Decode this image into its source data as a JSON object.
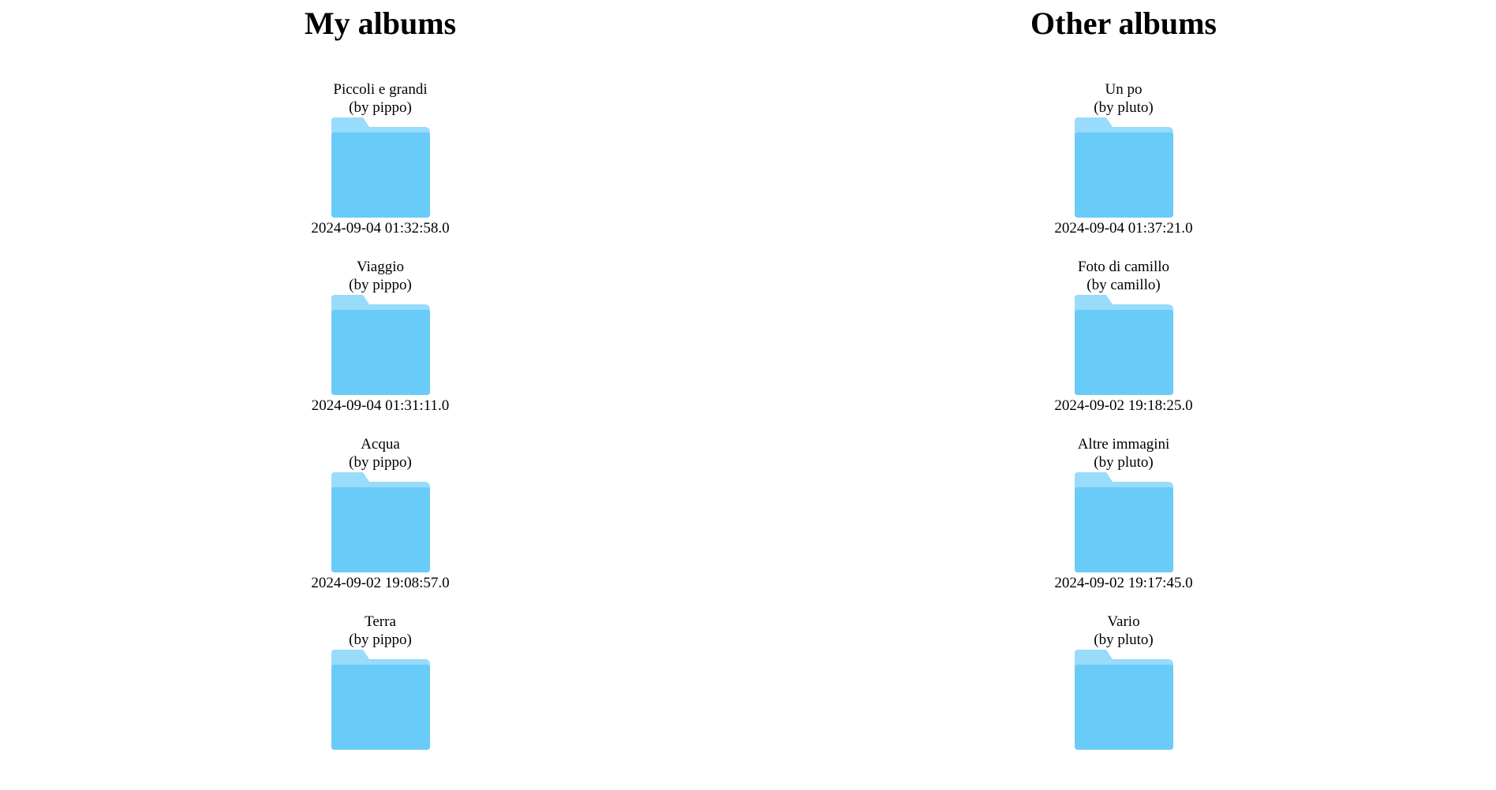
{
  "my_albums": {
    "heading": "My albums",
    "albums": [
      {
        "title": "Piccoli e grandi",
        "owner": "(by pippo)",
        "date": "2024-09-04 01:32:58.0"
      },
      {
        "title": "Viaggio",
        "owner": "(by pippo)",
        "date": "2024-09-04 01:31:11.0"
      },
      {
        "title": "Acqua",
        "owner": "(by pippo)",
        "date": "2024-09-02 19:08:57.0"
      },
      {
        "title": "Terra",
        "owner": "(by pippo)",
        "date": ""
      }
    ]
  },
  "other_albums": {
    "heading": "Other albums",
    "albums": [
      {
        "title": "Un po",
        "owner": "(by pluto)",
        "date": "2024-09-04 01:37:21.0"
      },
      {
        "title": "Foto di camillo",
        "owner": "(by camillo)",
        "date": "2024-09-02 19:18:25.0"
      },
      {
        "title": "Altre immagini",
        "owner": "(by pluto)",
        "date": "2024-09-02 19:17:45.0"
      },
      {
        "title": "Vario",
        "owner": "(by pluto)",
        "date": ""
      }
    ]
  },
  "icons": {
    "album": "folder-icon"
  },
  "colors": {
    "folder_front": "#69CBF8",
    "folder_back": "#98DBFA"
  }
}
